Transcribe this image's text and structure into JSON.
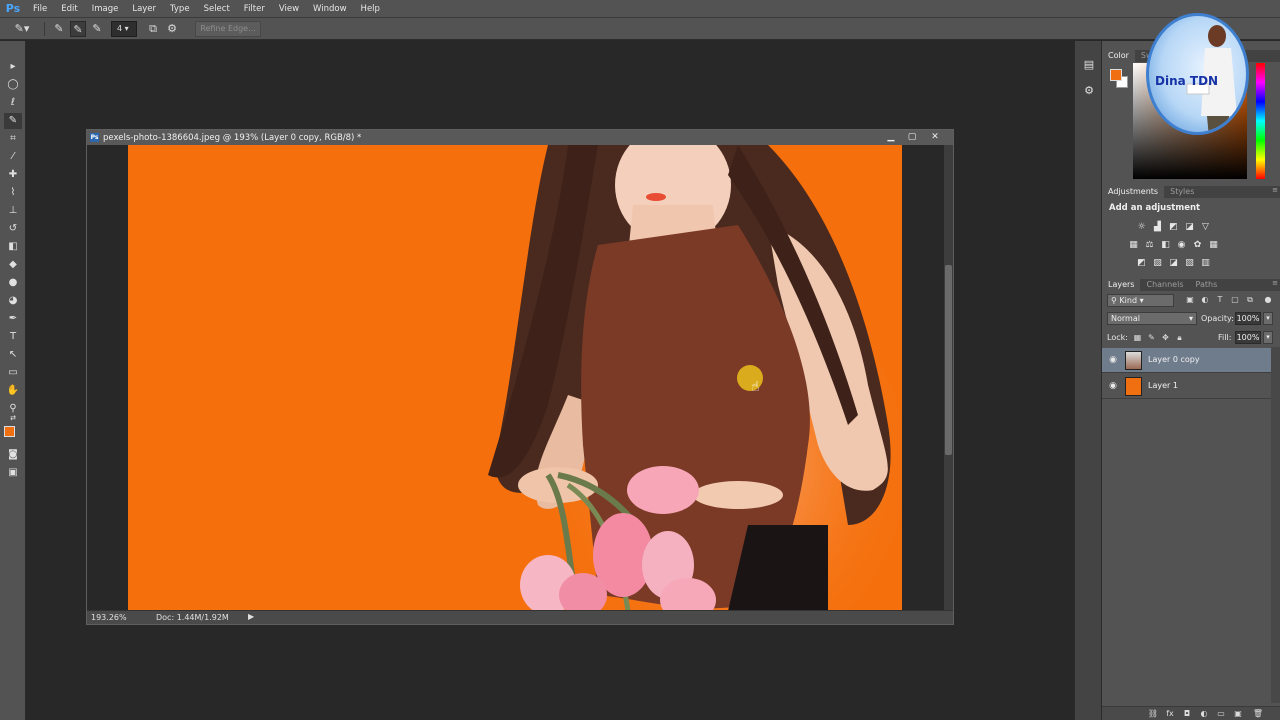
{
  "app": {
    "logo": "Ps",
    "menu": [
      "File",
      "Edit",
      "Image",
      "Layer",
      "Type",
      "Select",
      "Filter",
      "View",
      "Window",
      "Help"
    ]
  },
  "options_bar": {
    "brush_size": "4",
    "refine_edge_label": "Refine Edge..."
  },
  "colors": {
    "foreground": "#f07011",
    "background": "#ffffff",
    "canvas_orange": "#f56f0c",
    "selected_layer": "#6f7c8c"
  },
  "document": {
    "icon_label": "Ps",
    "title": "pexels-photo-1386604.jpeg @ 193% (Layer 0 copy, RGB/8) *",
    "zoom": "193.26%",
    "doc_size": "Doc: 1.44M/1.92M"
  },
  "panels": {
    "color_tabs": [
      "Color",
      "Sw"
    ],
    "adjustment_tabs": [
      "Adjustments",
      "Styles"
    ],
    "adjustment_title": "Add an adjustment",
    "layer_tabs": [
      "Layers",
      "Channels",
      "Paths"
    ]
  },
  "layers": {
    "kind_label": "Kind",
    "blend_mode": "Normal",
    "opacity_label": "Opacity:",
    "opacity": "100%",
    "lock_label": "Lock:",
    "fill_label": "Fill:",
    "fill": "100%",
    "items": [
      {
        "name": "Layer 0 copy",
        "selected": true
      },
      {
        "name": "Layer 1",
        "selected": false
      }
    ]
  },
  "watermark": {
    "text": "Dina TDN"
  }
}
